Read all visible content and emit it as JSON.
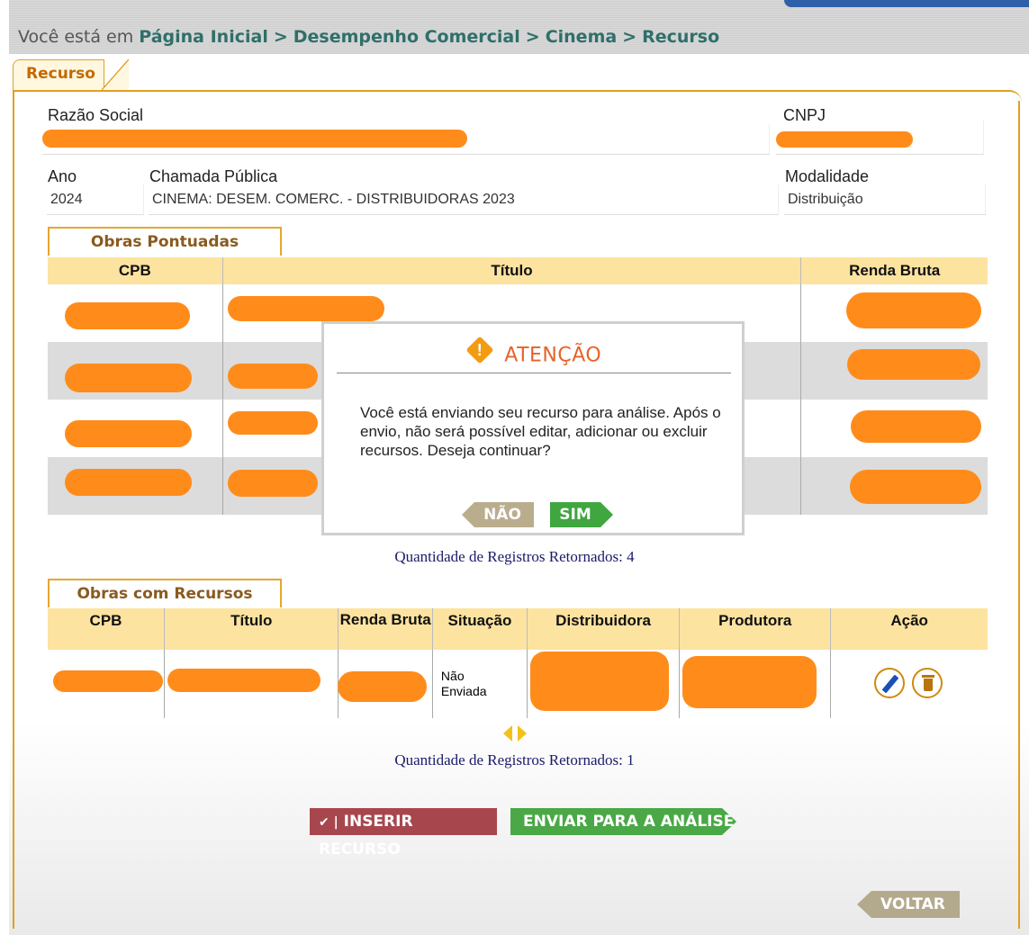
{
  "breadcrumb": {
    "prefix": "Você está em",
    "items": [
      "Página Inicial",
      "Desempenho Comercial",
      "Cinema",
      "Recurso"
    ],
    "separator": ">"
  },
  "tab": {
    "label": "Recurso"
  },
  "form": {
    "razao_social_label": "Razão Social",
    "cnpj_label": "CNPJ",
    "ano_label": "Ano",
    "ano_value": "2024",
    "chamada_label": "Chamada Pública",
    "chamada_value": "CINEMA: DESEM. COMERC. - DISTRIBUIDORAS 2023",
    "modalidade_label": "Modalidade",
    "modalidade_value": "Distribuição"
  },
  "obras_pontuadas": {
    "tab_label": "Obras Pontuadas",
    "columns": [
      "CPB",
      "Título",
      "Renda Bruta"
    ],
    "count_text": "Quantidade de Registros Retornados: 4"
  },
  "obras_recursos": {
    "tab_label": "Obras com Recursos",
    "columns": [
      "CPB",
      "Título",
      "Renda Bruta",
      "Situação",
      "Distribuidora",
      "Produtora",
      "Ação"
    ],
    "rows": [
      {
        "situacao": "Não Enviada"
      }
    ],
    "count_text": "Quantidade de Registros Retornados: 1"
  },
  "modal": {
    "title": "ATENÇÃO",
    "message": "Você está enviando seu recurso para análise. Após o envio, não será possível editar, adicionar ou excluir recursos. Deseja continuar?",
    "no_label": "NÃO",
    "yes_label": "SIM"
  },
  "buttons": {
    "inserir": "INSERIR RECURSO",
    "inserir_prefix": "✔ |",
    "enviar": "ENVIAR PARA A ANÁLISE",
    "voltar": "VOLTAR"
  },
  "colors": {
    "redaction": "#ff8c1a",
    "accent": "#e0a020",
    "header_bg": "#fde3a0",
    "breadcrumb_link": "#2f6f6a",
    "modal_title": "#e6632a"
  }
}
